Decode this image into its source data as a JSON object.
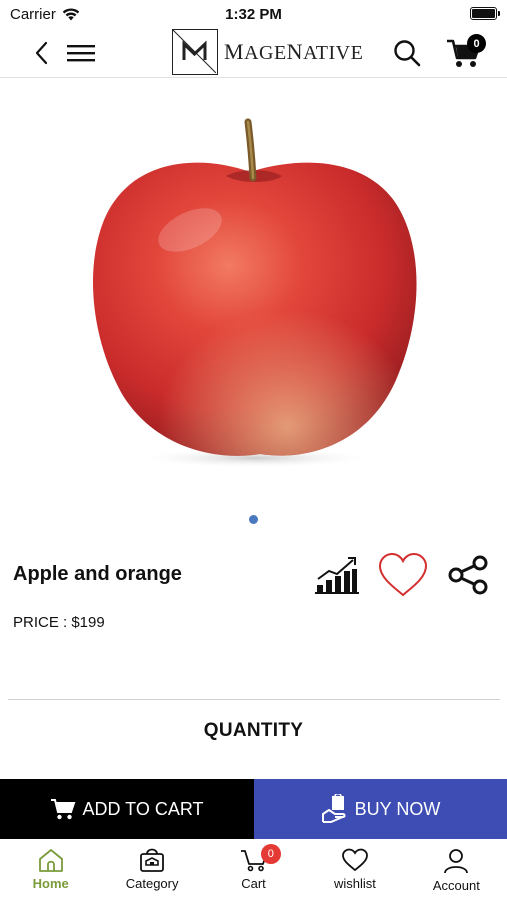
{
  "status_bar": {
    "carrier": "Carrier",
    "time": "1:32 PM"
  },
  "header": {
    "logo_text_cap1": "M",
    "logo_text_rest1": "AGE",
    "logo_text_cap2": "N",
    "logo_text_rest2": "ATIVE",
    "cart_count": "0"
  },
  "product": {
    "image_icon": "apple-photo",
    "name": "Apple and orange",
    "price": "PRICE : $199",
    "gallery_pages": 1,
    "gallery_active": 1
  },
  "quantity_label": "QUANTITY",
  "actions": {
    "add_to_cart": "ADD TO CART",
    "buy_now": "BUY NOW"
  },
  "bottom_nav": {
    "home": "Home",
    "category": "Category",
    "cart": "Cart",
    "cart_badge": "0",
    "wishlist": "wishlist",
    "account": "Account"
  },
  "colors": {
    "buy_now_bg": "#3d4db3",
    "add_to_cart_bg": "#000000",
    "active_nav": "#7a9b3a",
    "badge": "#e53935",
    "heart": "#d32f2f",
    "dot": "#4a78c0"
  }
}
